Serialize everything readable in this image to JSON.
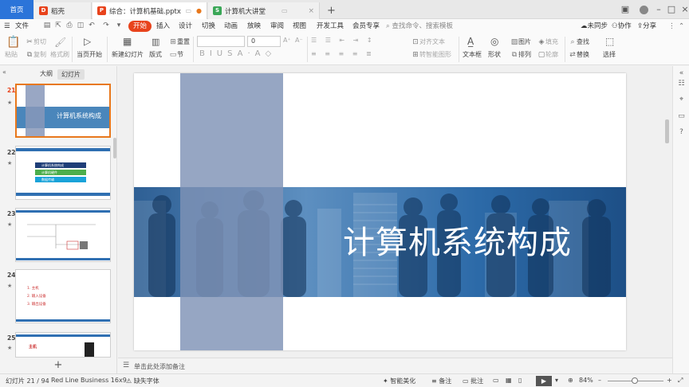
{
  "tabs": {
    "home": "首页",
    "docs": [
      {
        "label": "稻壳",
        "icon_color": "#e8431c",
        "icon_char": "D"
      },
      {
        "label": "综合：计算机基础.pptx",
        "icon_color": "#e8431c",
        "icon_char": "P"
      },
      {
        "label": "计算机大讲堂",
        "icon_color": "#3aa757",
        "icon_char": "S"
      }
    ],
    "new_tab": "+"
  },
  "menu": {
    "file": "文件",
    "items": [
      "开始",
      "插入",
      "设计",
      "切换",
      "动画",
      "放映",
      "审阅",
      "视图",
      "开发工具",
      "会员专享"
    ],
    "search_placeholder": "查找命令、搜索模板",
    "right": [
      "未同步",
      "协作",
      "分享"
    ]
  },
  "ribbon": {
    "paste": "粘贴",
    "cut": "剪切",
    "copy": "复制",
    "format_painter": "格式刷",
    "play_from_current": "当页开始",
    "new_slide": "新建幻灯片",
    "layout": "版式",
    "section": "节",
    "reset": "重置",
    "font_name": "",
    "font_size": "0",
    "text_dir": "对齐文本",
    "convert_smartart": "转智能图形",
    "textbox": "文本框",
    "shape": "形状",
    "picture": "图片",
    "arrange": "排列",
    "fill": "填充",
    "outline": "轮廓",
    "find": "查找",
    "replace": "替换",
    "select": "选择"
  },
  "panel": {
    "tab_outline": "大纲",
    "tab_slides": "幻灯片",
    "slides": [
      {
        "num": "21",
        "title": "计算机系统构成",
        "active": true
      },
      {
        "num": "22",
        "items": [
          "计算机系统构成",
          "计算机硬件",
          "数据传输"
        ]
      },
      {
        "num": "23"
      },
      {
        "num": "24",
        "lines": [
          "1. 主机",
          "2. 输入设备",
          "3. 输出设备"
        ]
      },
      {
        "num": "25",
        "lines": [
          "主机"
        ]
      }
    ],
    "add": "+"
  },
  "slide": {
    "title": "计算机系统构成"
  },
  "notes_placeholder": "单击此处添加备注",
  "status": {
    "slide_counter": "幻灯片 21 / 94",
    "theme": "Red Line Business 16x9",
    "missing_font": "缺失字体",
    "smart_beautify": "智能美化",
    "notes": "备注",
    "comments": "批注",
    "zoom": "84%"
  },
  "colors": {
    "accent": "#e8431c",
    "home_tab": "#2b74d9",
    "slide_band": "#3f7fb8",
    "slide_pillar": "#7f93b6"
  }
}
